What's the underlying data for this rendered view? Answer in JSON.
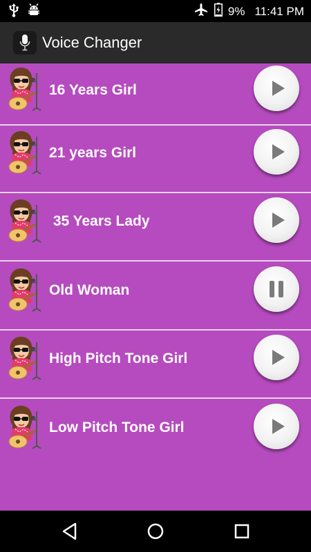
{
  "status_bar": {
    "battery": "9%",
    "time": "11:41 PM",
    "icons": [
      "usb-icon",
      "android-debug-icon",
      "airplane-mode-icon",
      "battery-charging-icon"
    ]
  },
  "app_bar": {
    "title": "Voice Changer",
    "icon": "microphone-icon"
  },
  "voices": [
    {
      "label": "16 Years Girl",
      "state": "play"
    },
    {
      "label": "21 years Girl",
      "state": "play"
    },
    {
      "label": " 35 Years Lady",
      "state": "play"
    },
    {
      "label": "Old Woman",
      "state": "pause"
    },
    {
      "label": "High Pitch Tone Girl",
      "state": "play"
    },
    {
      "label": "Low Pitch Tone Girl",
      "state": "play"
    }
  ],
  "colors": {
    "list_background": "#b64bbf",
    "divider": "#e9d4ec",
    "app_bar": "#2a2a2a"
  },
  "nav_bar": {
    "buttons": [
      "back-icon",
      "home-icon",
      "recent-apps-icon"
    ]
  }
}
